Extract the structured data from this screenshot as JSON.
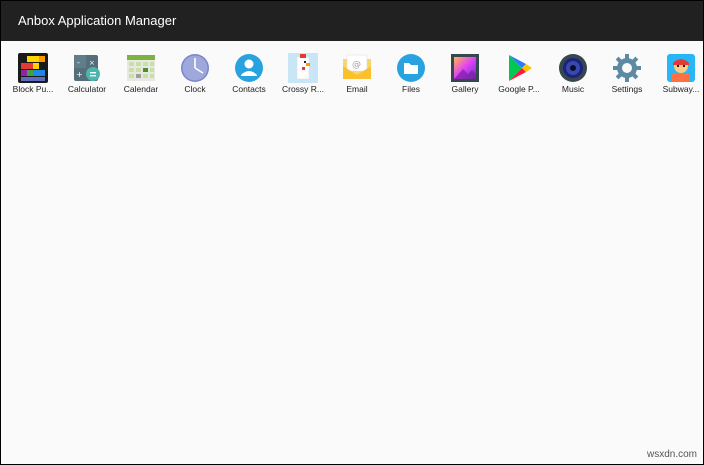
{
  "window": {
    "title": "Anbox Application Manager",
    "titlebar_color": "#212121",
    "background_color": "#fafafa"
  },
  "apps": [
    {
      "label": "Block Pu...",
      "icon": "block-puzzle-icon"
    },
    {
      "label": "Calculator",
      "icon": "calculator-icon"
    },
    {
      "label": "Calendar",
      "icon": "calendar-icon"
    },
    {
      "label": "Clock",
      "icon": "clock-icon"
    },
    {
      "label": "Contacts",
      "icon": "contacts-icon"
    },
    {
      "label": "Crossy R...",
      "icon": "crossy-road-icon"
    },
    {
      "label": "Email",
      "icon": "email-icon"
    },
    {
      "label": "Files",
      "icon": "files-icon"
    },
    {
      "label": "Gallery",
      "icon": "gallery-icon"
    },
    {
      "label": "Google P...",
      "icon": "google-play-icon"
    },
    {
      "label": "Music",
      "icon": "music-icon"
    },
    {
      "label": "Settings",
      "icon": "settings-icon"
    },
    {
      "label": "Subway...",
      "icon": "subway-surfers-icon"
    }
  ],
  "watermark": "wsxdn.com"
}
